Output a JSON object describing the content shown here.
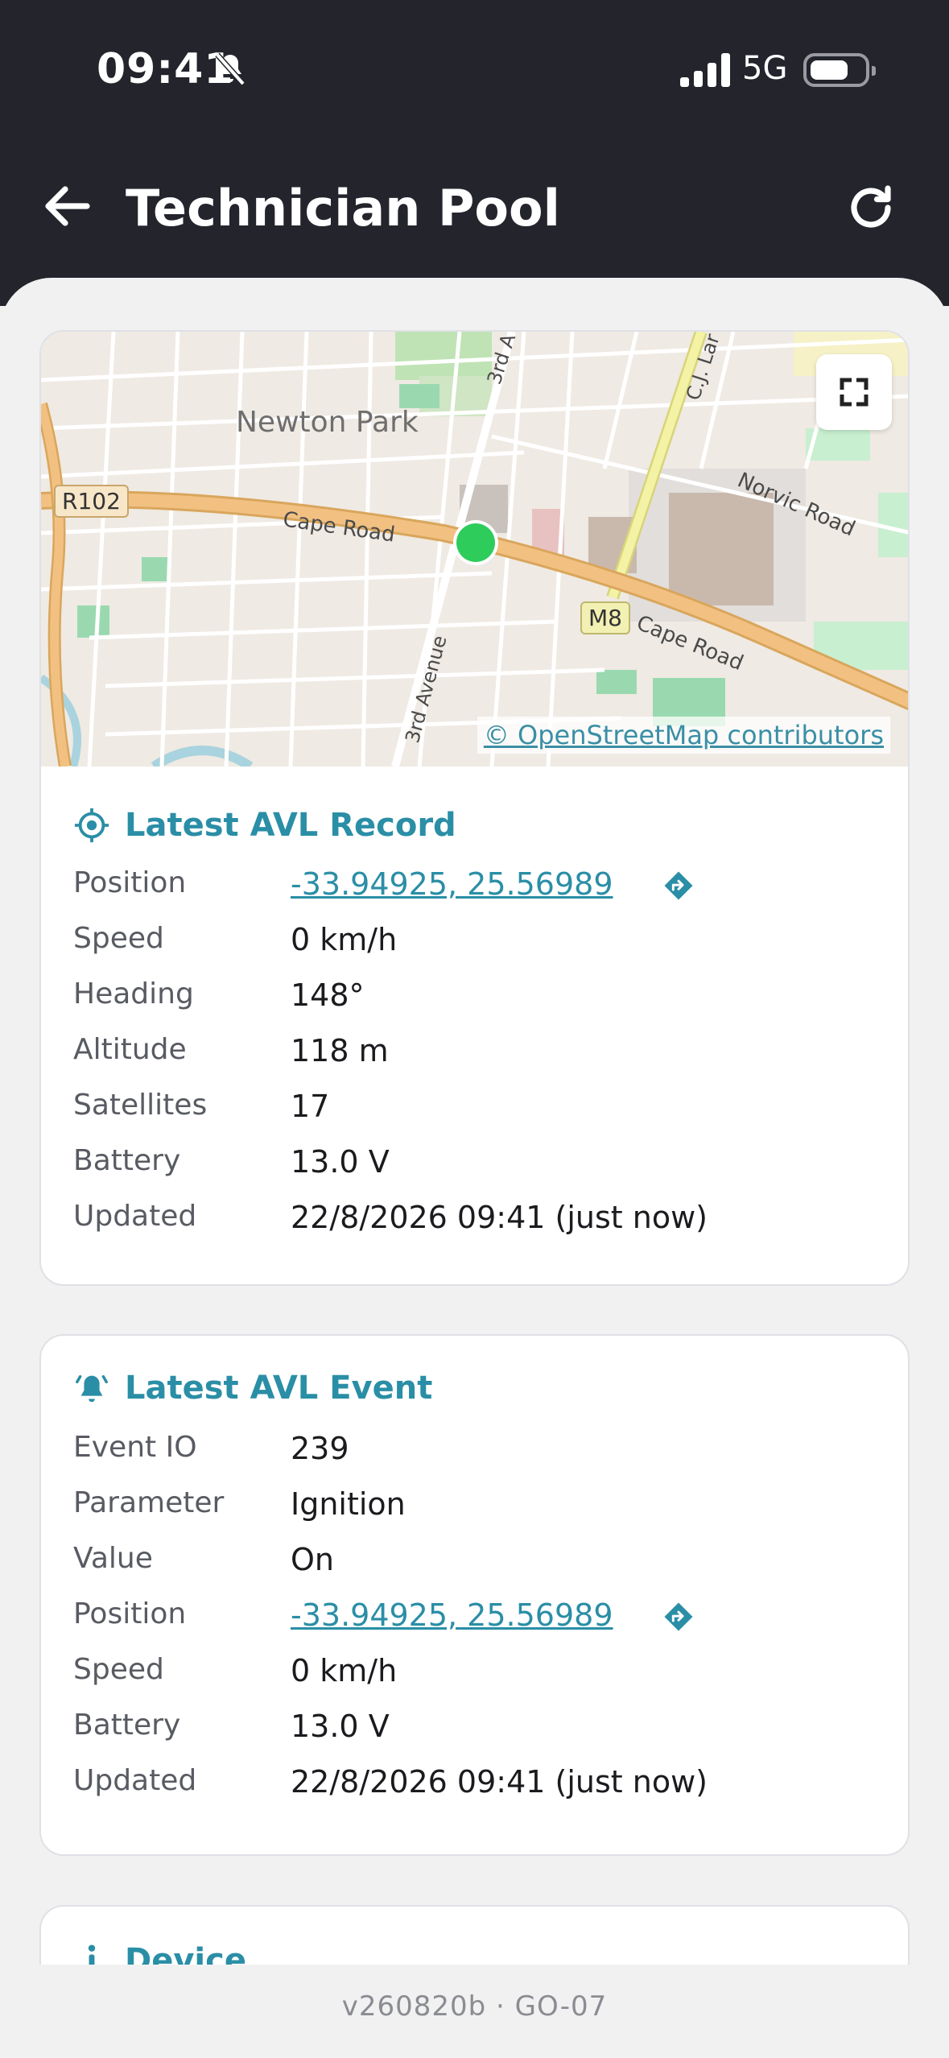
{
  "status_bar": {
    "time": "09:41",
    "network": "5G"
  },
  "header": {
    "title": "Technician Pool"
  },
  "map": {
    "labels": {
      "suburb": "Newton Park",
      "road_r102": "R102",
      "cape_road_1": "Cape Road",
      "cape_road_2": "Cape Road",
      "m8": "M8",
      "norvic_road": "Norvic Road",
      "third_ave_top": "3rd A",
      "third_avenue": "3rd Avenue",
      "cj_lane": "C.J. Lar"
    },
    "attribution": "© OpenStreetMap contributors",
    "marker_color": "#2ecc5b"
  },
  "latest_record": {
    "title": "Latest AVL Record",
    "rows": [
      {
        "label": "Position",
        "value": "-33.94925, 25.56989"
      },
      {
        "label": "Speed",
        "value": "0 km/h"
      },
      {
        "label": "Heading",
        "value": "148°"
      },
      {
        "label": "Altitude",
        "value": "118 m"
      },
      {
        "label": "Satellites",
        "value": "17"
      },
      {
        "label": "Battery",
        "value": "13.0 V"
      },
      {
        "label": "Updated",
        "value": "22/8/2026 09:41 (just now)"
      }
    ]
  },
  "latest_event": {
    "title": "Latest AVL Event",
    "rows": [
      {
        "label": "Event IO",
        "value": "239"
      },
      {
        "label": "Parameter",
        "value": "Ignition"
      },
      {
        "label": "Value",
        "value": "On"
      },
      {
        "label": "Position",
        "value": "-33.94925, 25.56989"
      },
      {
        "label": "Speed",
        "value": "0 km/h"
      },
      {
        "label": "Battery",
        "value": "13.0 V"
      },
      {
        "label": "Updated",
        "value": "22/8/2026 09:41 (just now)"
      }
    ]
  },
  "device": {
    "title": "Device"
  },
  "footer": {
    "version": "v260820b · GO-07"
  },
  "colors": {
    "accent": "#2a8ea6",
    "header_bg": "#23242c",
    "marker": "#2ecc5b"
  }
}
